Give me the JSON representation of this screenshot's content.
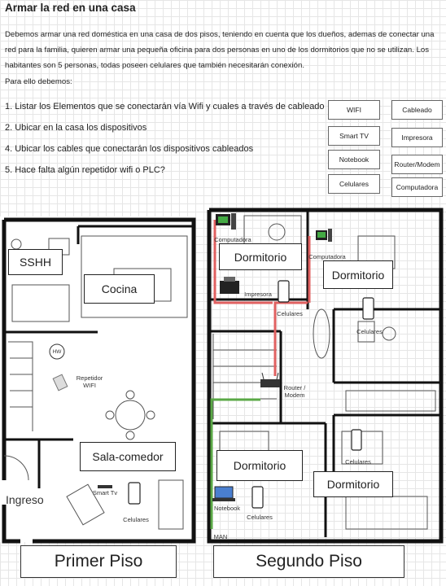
{
  "title": "Armar la red en una casa",
  "intro": [
    "Debemos armar una red doméstica en una casa de dos pisos, teniendo en cuenta que los dueños, ademas de conectar una",
    "red para la familia, quieren armar una pequeña oficina para dos personas en uno de los dormitorios que no se utilizan. Los",
    "habitantes son 5 personas, todas poseen celulares que también necesitarán conexión.",
    "Para ello debemos:"
  ],
  "tasks": [
    "1. Listar los Elementos que se conectarán vía Wifi y cuales a través de cableado",
    "2. Ubicar en la casa los dispositivos",
    "4. Ubicar los cables que conectarán los dispositivos cableados",
    "5. Hace falta algún repetidor wifi o PLC?"
  ],
  "tags": [
    "WIFI",
    "Cableado",
    "Smart TV",
    "Impresora",
    "Notebook",
    "Router/Modem",
    "Celulares",
    "Computadora"
  ],
  "floor1": {
    "label": "Primer Piso",
    "rooms": [
      "SSHH",
      "Cocina",
      "Sala-comedor"
    ],
    "hw": "HW",
    "ingreso": "Ingreso",
    "repetidor": "Repetidor WIFI",
    "smart_tv": "Smart Tv",
    "celulares": "Celulares"
  },
  "floor2": {
    "label": "Segundo Piso",
    "rooms": [
      "Dormitorio",
      "Dormitorio",
      "Dormitorio",
      "Dormitorio"
    ],
    "computadora_1": "Computadora",
    "computadora_2": "Computadora",
    "impresora": "Impresora",
    "celulares_1": "Celulares",
    "celulares_2": "Celulares",
    "celulares_3": "Celulares",
    "celulares_4": "Celulares",
    "router": "Router / Modem",
    "notebook": "Notebook",
    "man": "MAN"
  },
  "colors": {
    "cable_red": "#e06060",
    "cable_green": "#5aa846",
    "wall": "#111111"
  },
  "icons": [
    "computer-icon",
    "printer-icon",
    "phone-icon",
    "router-icon",
    "notebook-icon",
    "repeater-icon",
    "tv-icon"
  ]
}
